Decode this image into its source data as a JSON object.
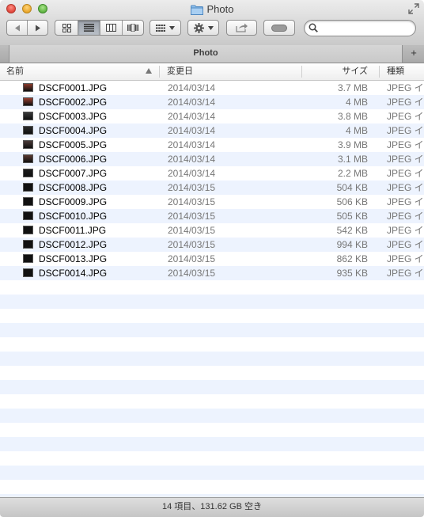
{
  "window": {
    "title": "Photo"
  },
  "toolbar": {
    "back": "◀",
    "forward": "▶",
    "view_modes": [
      "icon",
      "list",
      "column",
      "cover-flow"
    ],
    "active_view": "list",
    "search_placeholder": ""
  },
  "tabbar": {
    "tab_label": "Photo",
    "add_tab": "+"
  },
  "columns": {
    "name": "名前",
    "date": "変更日",
    "size": "サイズ",
    "kind": "種類"
  },
  "files": [
    {
      "name": "DSCF0001.JPG",
      "date": "2014/03/14",
      "size": "3.7 MB",
      "kind": "JPEG イメージ",
      "thumb": "#8b3a2a"
    },
    {
      "name": "DSCF0002.JPG",
      "date": "2014/03/14",
      "size": "4 MB",
      "kind": "JPEG イメージ",
      "thumb": "#9a4030"
    },
    {
      "name": "DSCF0003.JPG",
      "date": "2014/03/14",
      "size": "3.8 MB",
      "kind": "JPEG イメージ",
      "thumb": "#3a3a3a"
    },
    {
      "name": "DSCF0004.JPG",
      "date": "2014/03/14",
      "size": "4 MB",
      "kind": "JPEG イメージ",
      "thumb": "#2a2a2a"
    },
    {
      "name": "DSCF0005.JPG",
      "date": "2014/03/14",
      "size": "3.9 MB",
      "kind": "JPEG イメージ",
      "thumb": "#4a3a38"
    },
    {
      "name": "DSCF0006.JPG",
      "date": "2014/03/14",
      "size": "3.1 MB",
      "kind": "JPEG イメージ",
      "thumb": "#5a3a30"
    },
    {
      "name": "DSCF0007.JPG",
      "date": "2014/03/14",
      "size": "2.2 MB",
      "kind": "JPEG イメージ",
      "thumb": "#1c1c1c"
    },
    {
      "name": "DSCF0008.JPG",
      "date": "2014/03/15",
      "size": "504 KB",
      "kind": "JPEG イメージ",
      "thumb": "#111111"
    },
    {
      "name": "DSCF0009.JPG",
      "date": "2014/03/15",
      "size": "506 KB",
      "kind": "JPEG イメージ",
      "thumb": "#111111"
    },
    {
      "name": "DSCF0010.JPG",
      "date": "2014/03/15",
      "size": "505 KB",
      "kind": "JPEG イメージ",
      "thumb": "#111111"
    },
    {
      "name": "DSCF0011.JPG",
      "date": "2014/03/15",
      "size": "542 KB",
      "kind": "JPEG イメージ",
      "thumb": "#111111"
    },
    {
      "name": "DSCF0012.JPG",
      "date": "2014/03/15",
      "size": "994 KB",
      "kind": "JPEG イメージ",
      "thumb": "#111111"
    },
    {
      "name": "DSCF0013.JPG",
      "date": "2014/03/15",
      "size": "862 KB",
      "kind": "JPEG イメージ",
      "thumb": "#111111"
    },
    {
      "name": "DSCF0014.JPG",
      "date": "2014/03/15",
      "size": "935 KB",
      "kind": "JPEG イメージ",
      "thumb": "#111111"
    }
  ],
  "status": {
    "text": "14 項目、131.62 GB 空き"
  },
  "colors": {
    "stripe": "#edf3fe",
    "accent_folder": "#7eb3e6"
  }
}
